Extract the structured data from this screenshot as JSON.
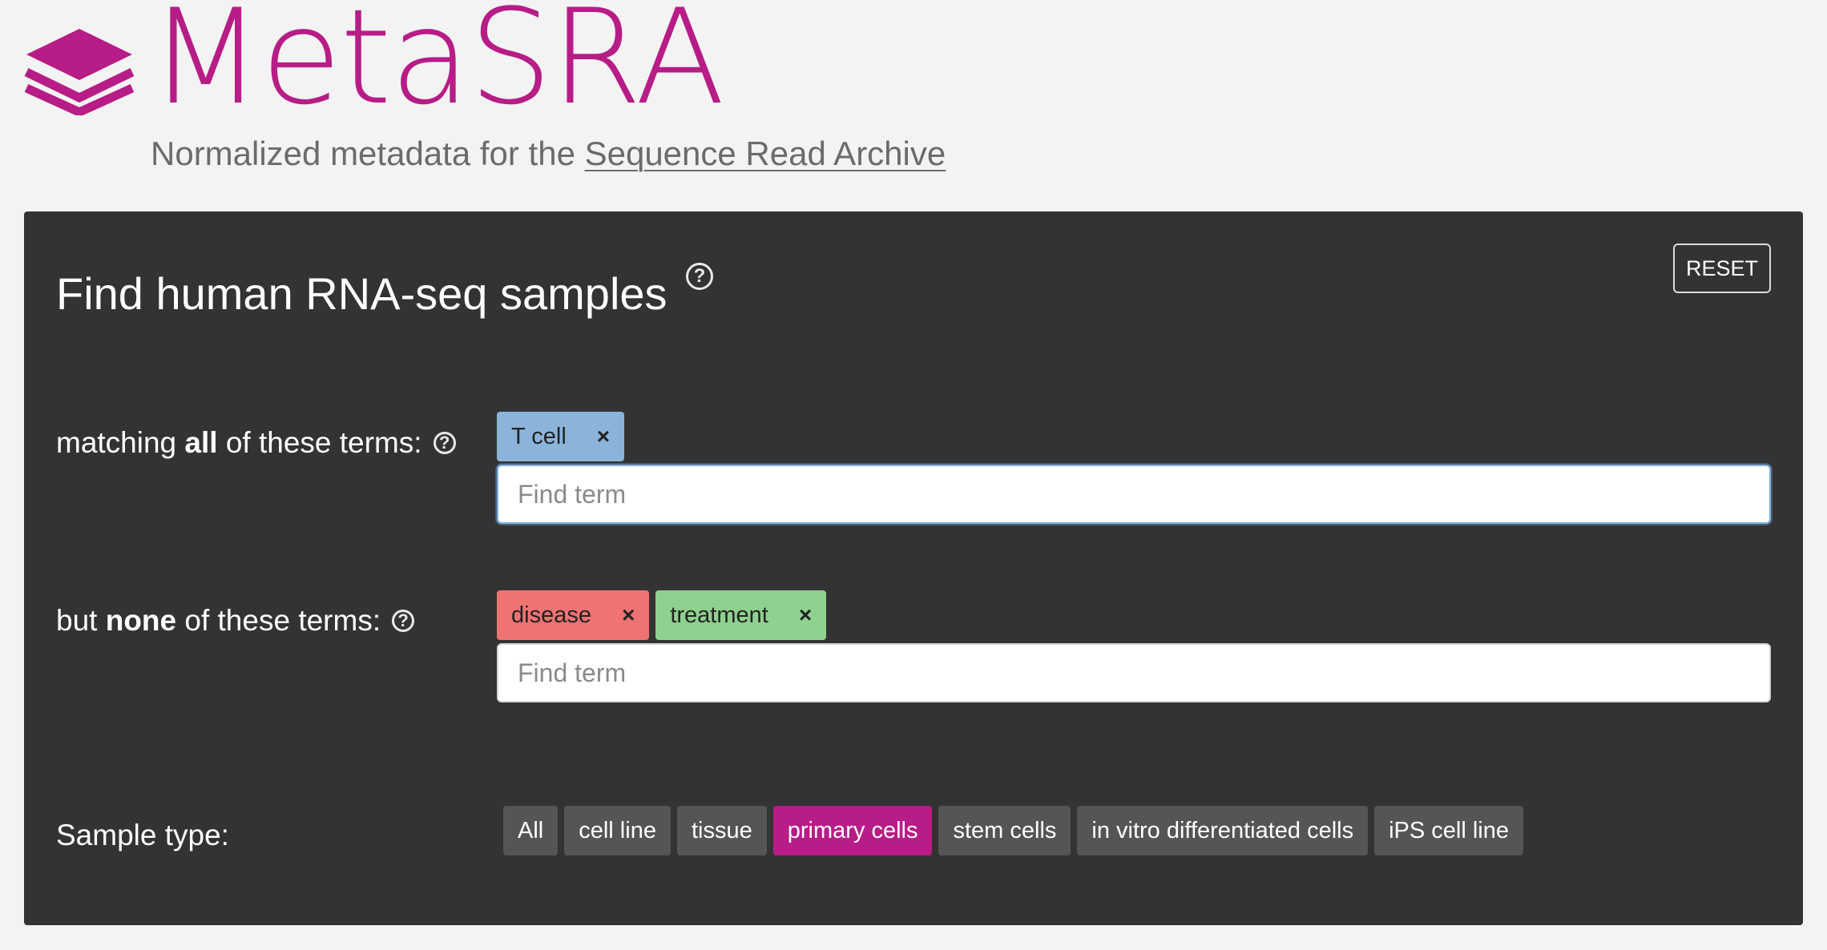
{
  "brand": {
    "title": "MetaSRA",
    "tagline_prefix": "Normalized metadata for the ",
    "tagline_link": "Sequence Read Archive",
    "accent_color": "#b71c87",
    "logo_icon": "stacked-layers-icon"
  },
  "panel": {
    "title": "Find human RNA-seq samples",
    "help_icon": "question-circle-icon",
    "reset_label": "RESET"
  },
  "include": {
    "label_pre": "matching ",
    "label_bold": "all",
    "label_post": " of these terms:",
    "terms": [
      {
        "label": "T cell",
        "color": "#8cb4da"
      }
    ],
    "placeholder": "Find term"
  },
  "exclude": {
    "label_pre": "but ",
    "label_bold": "none",
    "label_post": " of these terms:",
    "terms": [
      {
        "label": "disease",
        "color": "#f07373"
      },
      {
        "label": "treatment",
        "color": "#8fd18f"
      }
    ],
    "placeholder": "Find term"
  },
  "remove_glyph": "×",
  "sample_type": {
    "label": "Sample type:",
    "options": [
      "All",
      "cell line",
      "tissue",
      "primary cells",
      "stem cells",
      "in vitro differentiated cells",
      "iPS cell line"
    ],
    "selected": "primary cells"
  }
}
